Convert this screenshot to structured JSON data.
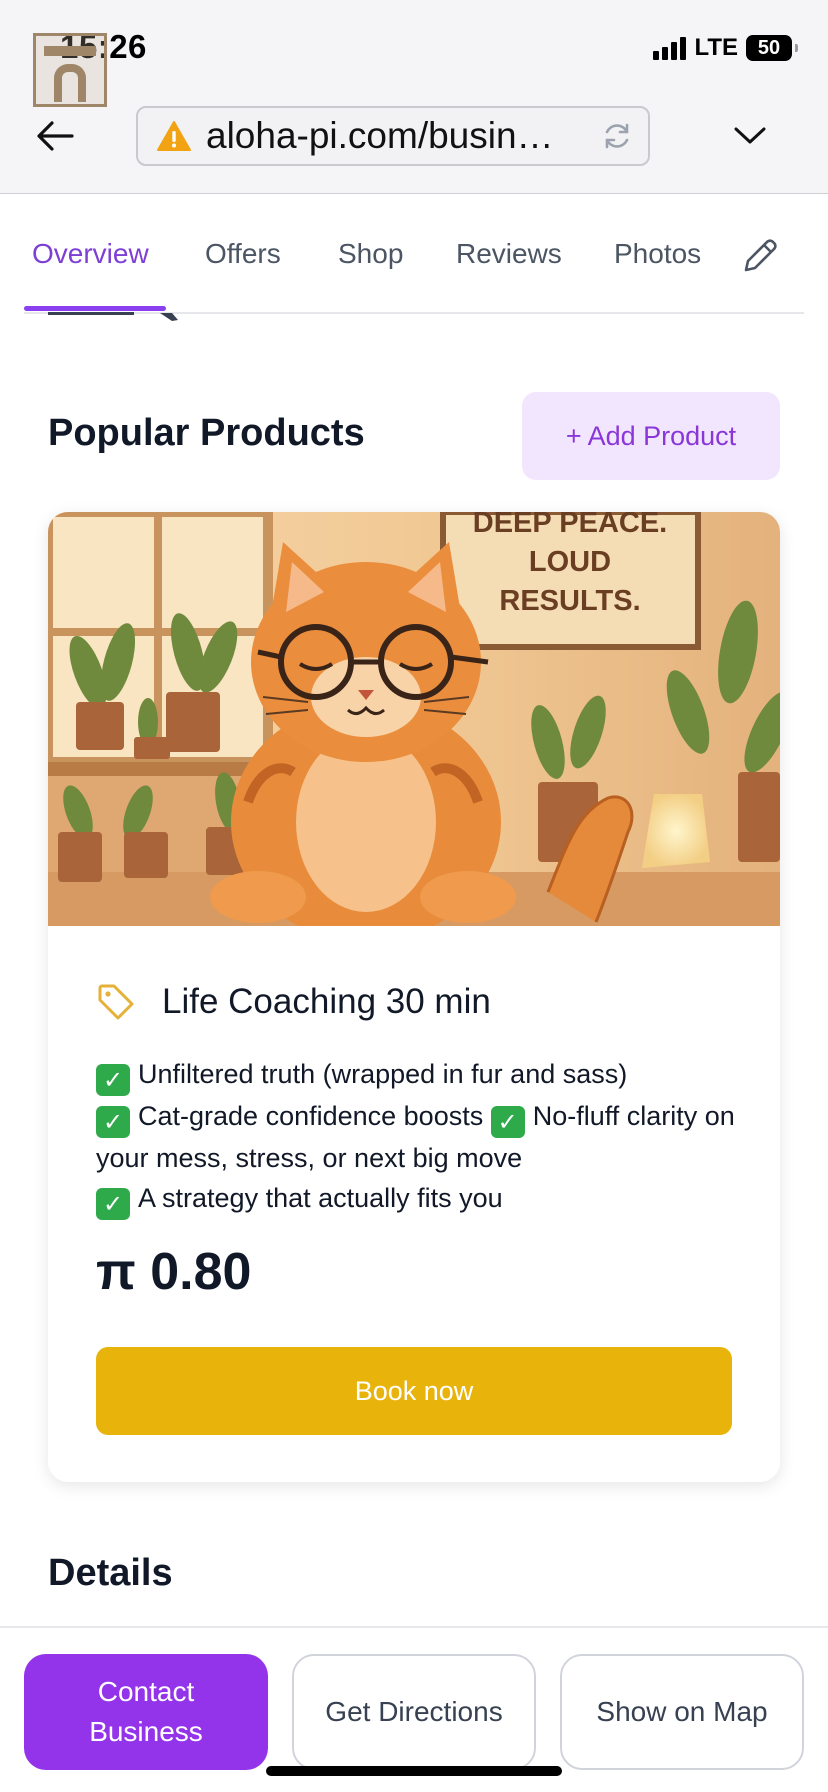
{
  "status_bar": {
    "time": "15:26",
    "network": "LTE",
    "battery": "50"
  },
  "browser": {
    "url": "aloha-pi.com/busin…"
  },
  "tabs": [
    {
      "label": "Overview",
      "active": true
    },
    {
      "label": "Offers",
      "active": false
    },
    {
      "label": "Shop",
      "active": false
    },
    {
      "label": "Reviews",
      "active": false
    },
    {
      "label": "Photos",
      "active": false
    }
  ],
  "popular_products": {
    "title": "Popular Products",
    "add_label": "+ Add Product",
    "product": {
      "image_sign": [
        "DEEP PEACE.",
        "LOUD",
        "RESULTS."
      ],
      "name": "Life Coaching 30 min",
      "description": [
        {
          "check": true,
          "text": "Unfiltered truth (wrapped in fur and sass)"
        },
        {
          "check": true,
          "text": "Cat-grade confidence boosts "
        },
        {
          "check": true,
          "text": "No-fluff clarity on your mess, stress, or next big move"
        },
        {
          "check": true,
          "text": "A strategy that actually fits you"
        }
      ],
      "price": "π 0.80",
      "cta": "Book now"
    }
  },
  "details": {
    "title": "Details"
  },
  "bottom_actions": {
    "contact": "Contact Business",
    "directions": "Get Directions",
    "map": "Show on Map"
  },
  "colors": {
    "accent": "#9333ea",
    "tab_active": "#7e3fd4",
    "book_button": "#e8b40c",
    "add_button_bg": "#f1e6fd",
    "check_green": "#2eaa4a"
  },
  "icons": [
    "back-arrow-icon",
    "warning-icon",
    "reload-icon",
    "chevron-down-icon",
    "pencil-icon",
    "tag-icon",
    "checkmark-icon"
  ]
}
